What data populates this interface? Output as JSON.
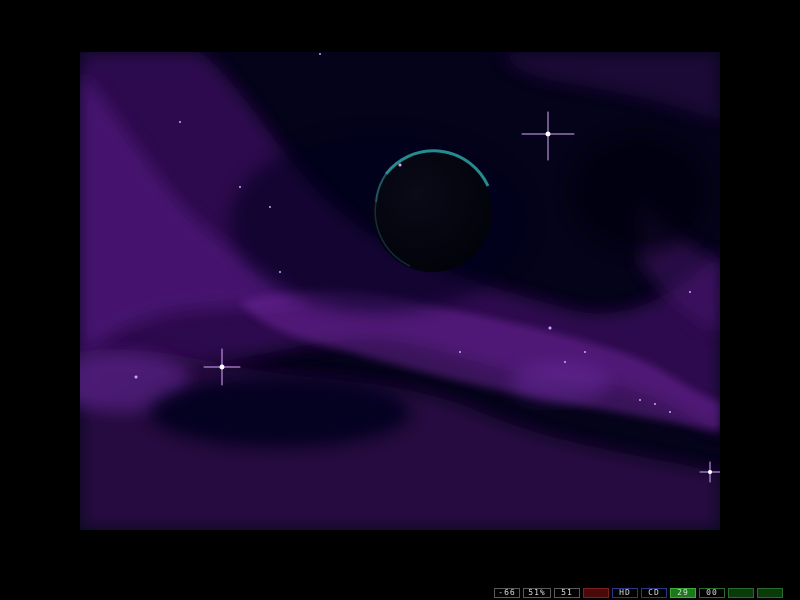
{
  "status_bar": {
    "items": [
      {
        "id": "volume",
        "label": "-66",
        "bg": "#000000",
        "border": "#5a5a5a"
      },
      {
        "id": "speed",
        "label": "51%",
        "bg": "#000000",
        "border": "#5a5a5a"
      },
      {
        "id": "fps",
        "label": "51",
        "bg": "#000000",
        "border": "#5a5a5a"
      },
      {
        "id": "power-led",
        "label": "",
        "bg": "#4a0a0a",
        "border": "#7a2020"
      },
      {
        "id": "hd-led",
        "label": "HD",
        "bg": "#000000",
        "border": "#2a3a8a"
      },
      {
        "id": "cd-led",
        "label": "CD",
        "bg": "#000000",
        "border": "#2a3a8a"
      },
      {
        "id": "drive0-led",
        "label": "29",
        "bg": "#1a7a1a",
        "border": "#3aaa3a"
      },
      {
        "id": "drive1-led",
        "label": "00",
        "bg": "#000000",
        "border": "#2a6a2a"
      },
      {
        "id": "drive2-led",
        "label": "",
        "bg": "#0a3a0a",
        "border": "#2a6a2a"
      },
      {
        "id": "drive3-led",
        "label": "",
        "bg": "#0a3a0a",
        "border": "#2a6a2a"
      }
    ]
  },
  "scene": {
    "colors": {
      "space": "#05031a",
      "nebula": "#5a1a8a",
      "nebula_bright": "#8a3ab8",
      "planet_rim": "#2a8a8a",
      "star": "#e8b8ff"
    },
    "icons": [
      "planet-icon",
      "star-icon"
    ]
  }
}
